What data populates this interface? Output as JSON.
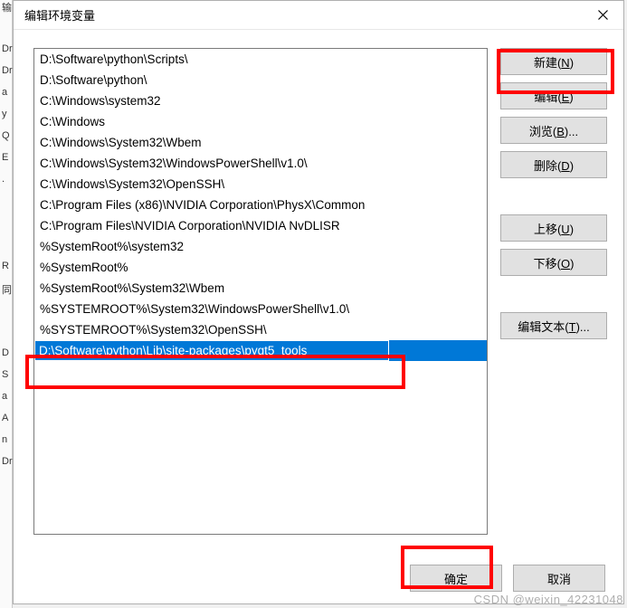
{
  "dialog": {
    "title": "编辑环境变量"
  },
  "list": {
    "items": [
      "D:\\Software\\python\\Scripts\\",
      "D:\\Software\\python\\",
      "C:\\Windows\\system32",
      "C:\\Windows",
      "C:\\Windows\\System32\\Wbem",
      "C:\\Windows\\System32\\WindowsPowerShell\\v1.0\\",
      "C:\\Windows\\System32\\OpenSSH\\",
      "C:\\Program Files (x86)\\NVIDIA Corporation\\PhysX\\Common",
      "C:\\Program Files\\NVIDIA Corporation\\NVIDIA NvDLISR",
      "%SystemRoot%\\system32",
      "%SystemRoot%",
      "%SystemRoot%\\System32\\Wbem",
      "%SYSTEMROOT%\\System32\\WindowsPowerShell\\v1.0\\",
      "%SYSTEMROOT%\\System32\\OpenSSH\\"
    ],
    "editing_value": "D:\\Software\\python\\Lib\\site-packages\\pyqt5_tools"
  },
  "buttons": {
    "new": "新建(N)",
    "edit": "编辑(E)",
    "browse": "浏览(B)...",
    "delete": "删除(D)",
    "move_up": "上移(U)",
    "move_down": "下移(O)",
    "edit_text": "编辑文本(T)...",
    "ok": "确定",
    "cancel": "取消"
  },
  "watermark": "CSDN @weixin_42231048",
  "left_strip": [
    "输",
    "",
    "Dr",
    "Dr",
    "a",
    "y",
    "Q",
    "E",
    ".",
    "",
    "",
    "",
    "R",
    "同",
    "",
    "",
    "D",
    "S",
    "a",
    "A",
    "n",
    "Dr"
  ]
}
